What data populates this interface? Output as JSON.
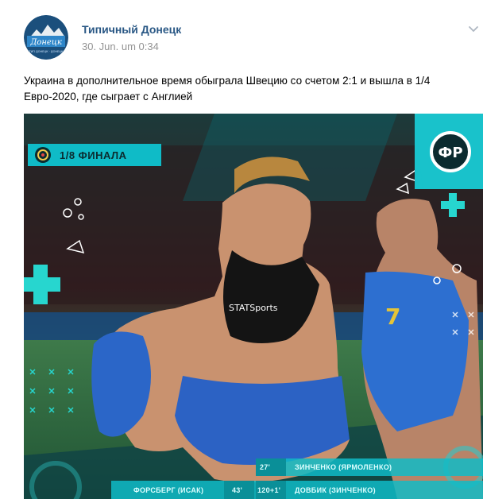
{
  "post": {
    "author": "Типичный Донецк",
    "date": "30. Jun. um 0:34",
    "text": "Украина в дополнительное время обыграла Швецию со счетом 2:1 и вышла в 1/4 Евро-2020, где сыграет с Англией"
  },
  "avatar": {
    "logo_text": "Донецк",
    "sub_text": "ТИП ДОНЕЦК · ДОНЕЦК"
  },
  "media": {
    "stage_badge": "1/8 ФИНАЛА",
    "brand_logo": "ФР",
    "jersey_text": "STATSports",
    "scorers": {
      "row1": {
        "minute": "27'",
        "player": "ЗИНЧЕНКО (ЯРМОЛЕНКО)"
      },
      "row2": {
        "opponent": "ФОРСБЕРГ (ИСАК)",
        "opponent_minute": "43'",
        "minute": "120+1'",
        "player": "ДОВБИК (ЗИНЧЕНКО)"
      }
    }
  },
  "colors": {
    "link": "#2a5885",
    "accent": "#0fbbc7",
    "dark": "#0d2b2c"
  },
  "icons": [
    "chevron-down-icon",
    "euro-trophy-icon",
    "plus-icon",
    "triangle-icon",
    "circle-icon",
    "x-mark-icon"
  ]
}
